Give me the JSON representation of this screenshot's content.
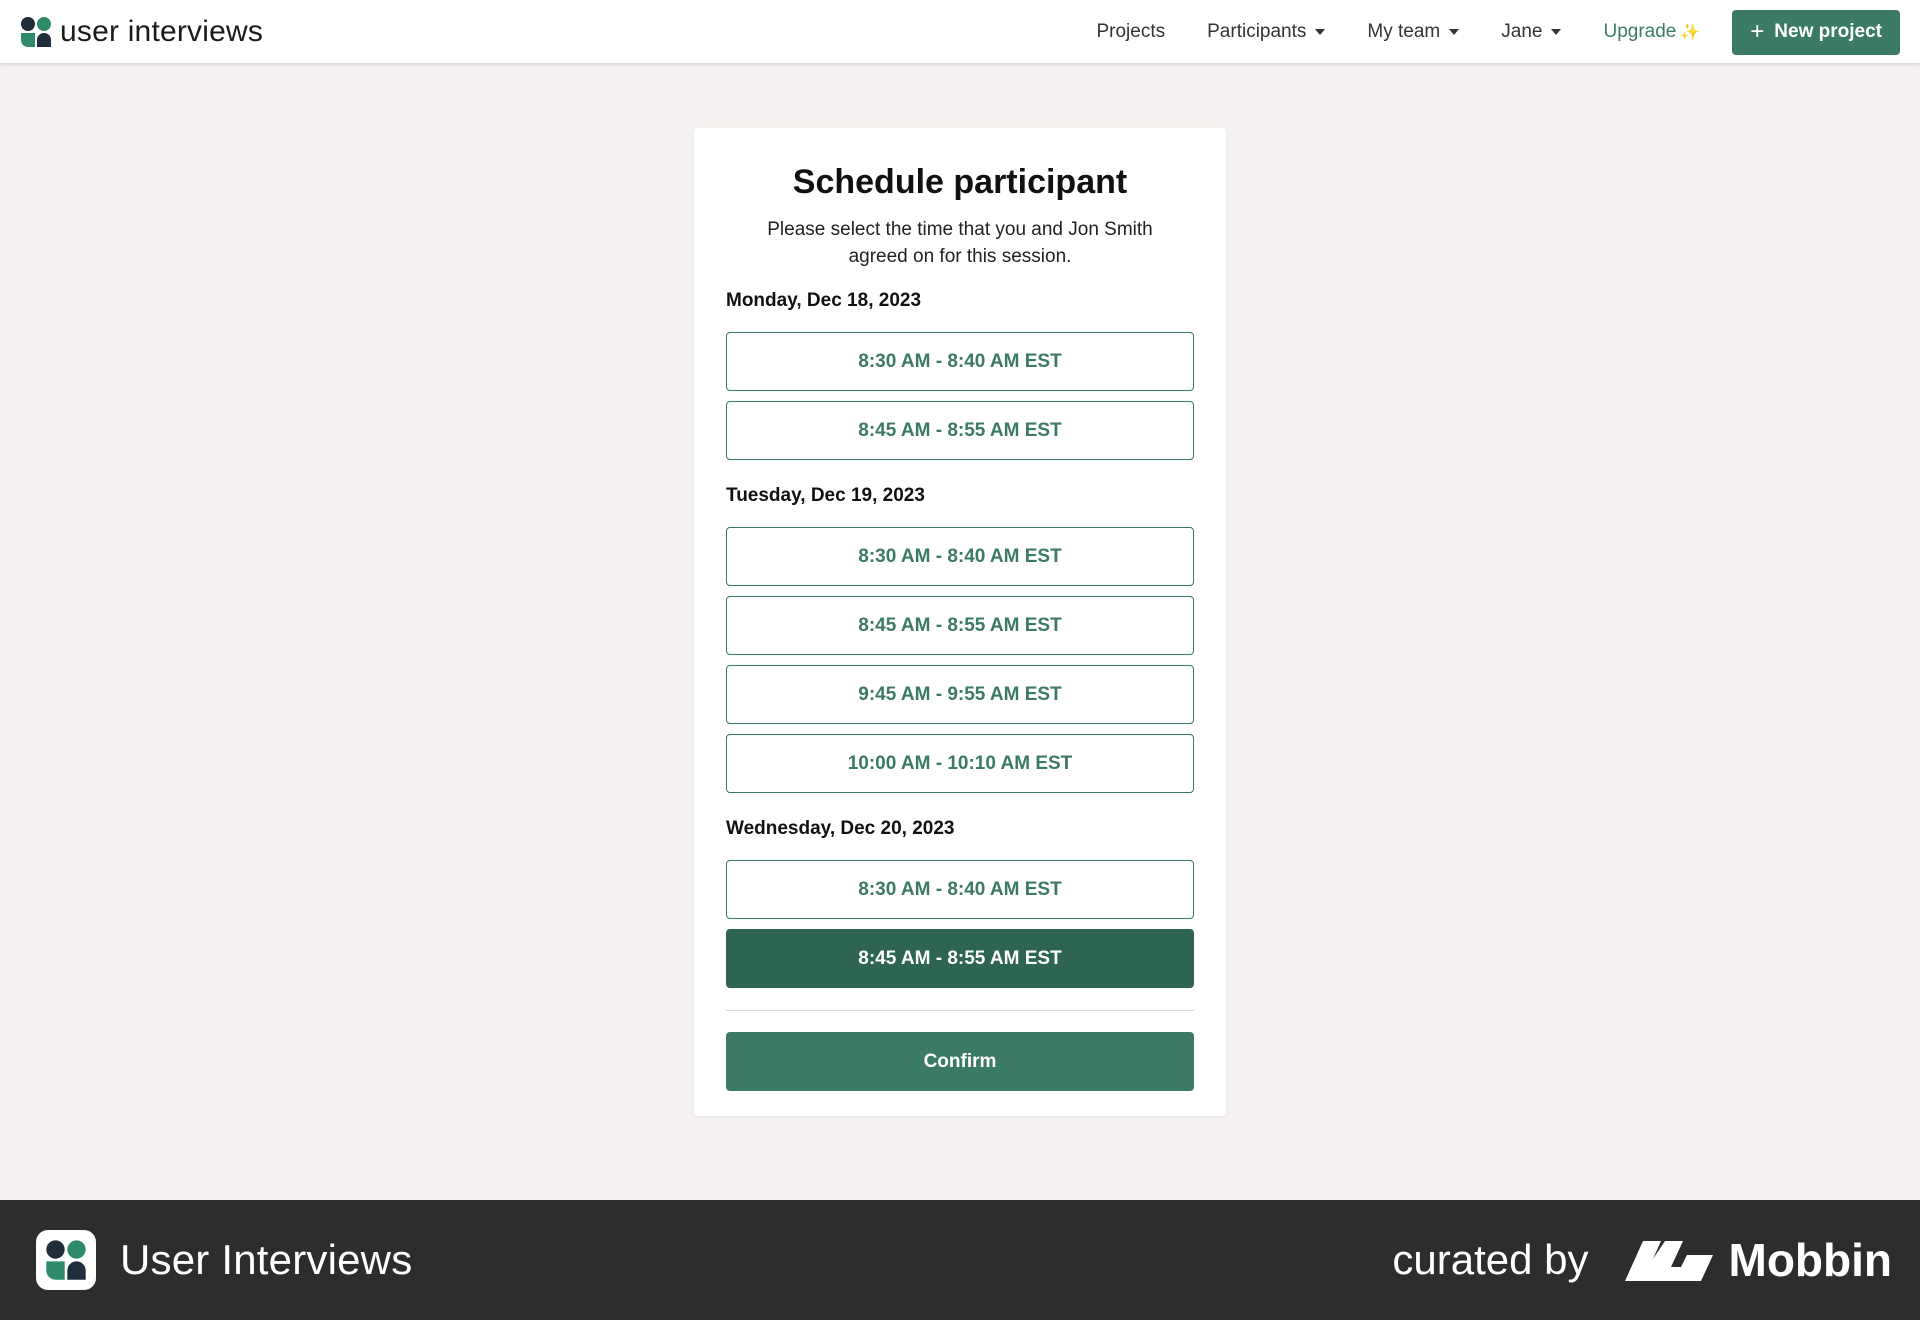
{
  "app": {
    "brand_name": "user interviews"
  },
  "nav": {
    "items": [
      {
        "label": "Projects"
      },
      {
        "label": "Participants"
      },
      {
        "label": "My team"
      },
      {
        "label": "Jane"
      }
    ],
    "upgrade_label": "Upgrade",
    "upgrade_sparkle": "✨",
    "new_project_label": "New project",
    "accent_color": "#3b7a65"
  },
  "card": {
    "title": "Schedule participant",
    "description": "Please select the time that you and Jon Smith agreed on for this session.",
    "days": [
      {
        "label": "Monday, Dec 18, 2023",
        "slots": [
          {
            "label": "8:30 AM - 8:40 AM EST",
            "selected": false
          },
          {
            "label": "8:45 AM - 8:55 AM EST",
            "selected": false
          }
        ]
      },
      {
        "label": "Tuesday, Dec 19, 2023",
        "slots": [
          {
            "label": "8:30 AM - 8:40 AM EST",
            "selected": false
          },
          {
            "label": "8:45 AM - 8:55 AM EST",
            "selected": false
          },
          {
            "label": "9:45 AM - 9:55 AM EST",
            "selected": false
          },
          {
            "label": "10:00 AM - 10:10 AM EST",
            "selected": false
          }
        ]
      },
      {
        "label": "Wednesday, Dec 20, 2023",
        "slots": [
          {
            "label": "8:30 AM - 8:40 AM EST",
            "selected": false
          },
          {
            "label": "8:45 AM - 8:55 AM EST",
            "selected": true
          }
        ]
      }
    ],
    "confirm_label": "Confirm"
  },
  "footer": {
    "app_name": "User Interviews",
    "curated_by": "curated by",
    "mobbin_name": "Mobbin"
  }
}
